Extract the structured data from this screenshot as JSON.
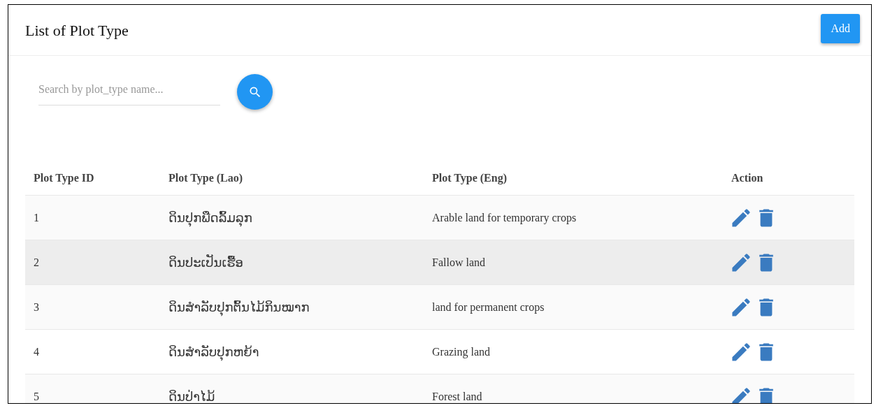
{
  "header": {
    "title": "List of Plot Type",
    "add_button": "Add"
  },
  "search": {
    "placeholder": "Search by plot_type name..."
  },
  "table": {
    "columns": [
      "Plot Type ID",
      "Plot Type (Lao)",
      "Plot Type (Eng)",
      "Action"
    ],
    "rows": [
      {
        "id": "1",
        "lao": "ດິນປຸກພືດລົ້ມລຸກ",
        "eng": "Arable land for temporary crops",
        "hovered": false
      },
      {
        "id": "2",
        "lao": "ດິນປະເປັນເຮື້ອ",
        "eng": "Fallow land",
        "hovered": true
      },
      {
        "id": "3",
        "lao": "ດິນສໍາລັບປຸກຕົ້ນໄມ້ກິນໝາກ",
        "eng": "land for permanent crops",
        "hovered": false
      },
      {
        "id": "4",
        "lao": "ດິນສໍາລັບປຸກຫຍ້າ",
        "eng": "Grazing land",
        "hovered": false
      },
      {
        "id": "5",
        "lao": "ດິນປ່າໄມ້",
        "eng": "Forest land",
        "hovered": false
      }
    ]
  }
}
